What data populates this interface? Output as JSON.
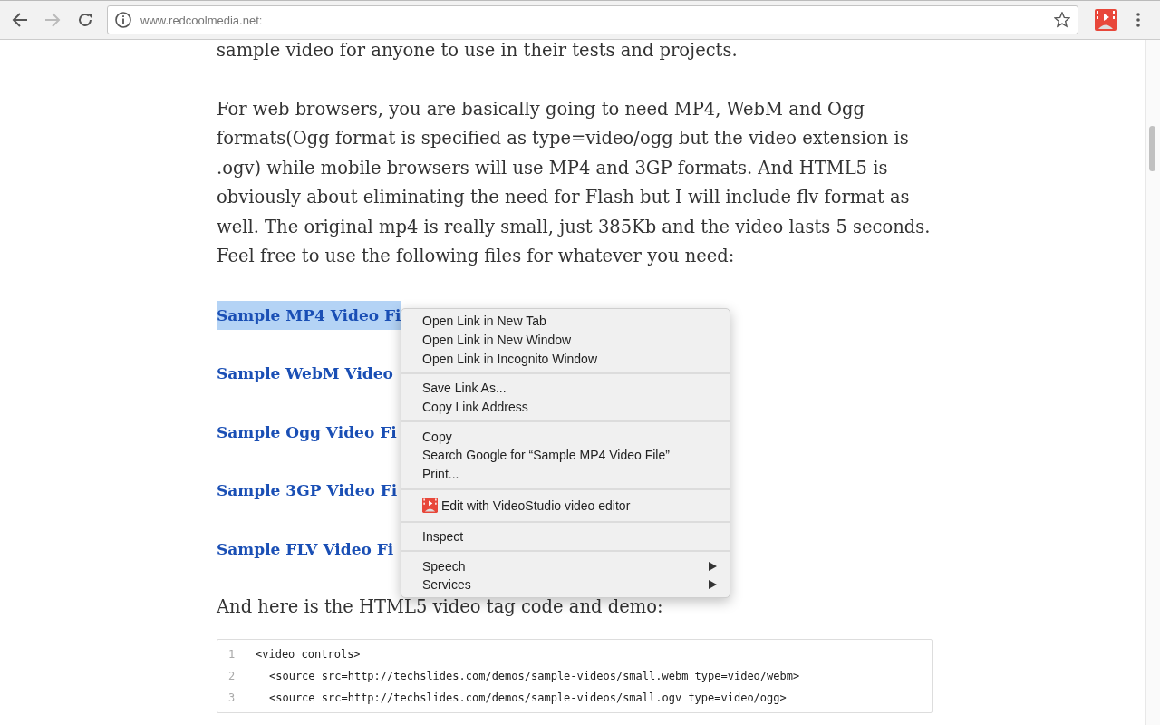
{
  "toolbar": {
    "url_host": "www.redcoolmedia.net",
    "url_rest": ":",
    "bookmarked": false
  },
  "article": {
    "paragraphs": [
      "sample video for anyone to use in their tests and projects.",
      "For web browsers, you are basically going to need MP4, WebM and Ogg formats(Ogg format is specified as type=video/ogg but the video extension is .ogv) while mobile browsers will use MP4 and 3GP formats. And HTML5 is obviously about eliminating the need for Flash but I will include flv format as well. The original mp4 is really small, just 385Kb and the video lasts 5 seconds. Feel free to use the following files for whatever you need:"
    ],
    "links": [
      {
        "label": "Sample MP4 Video Fi",
        "selected": true
      },
      {
        "label": "Sample WebM Video",
        "selected": false
      },
      {
        "label": "Sample Ogg Video Fi",
        "selected": false
      },
      {
        "label": "Sample 3GP Video Fi",
        "selected": false
      },
      {
        "label": "Sample FLV Video Fi",
        "selected": false
      }
    ],
    "after_links": "And here is the HTML5 video tag code and demo:",
    "code": [
      {
        "number": "1",
        "line": "<video controls>",
        "indent": false
      },
      {
        "number": "2",
        "line": "<source src=http://techslides.com/demos/sample-videos/small.webm type=video/webm>",
        "indent": true
      },
      {
        "number": "3",
        "line": "<source src=http://techslides.com/demos/sample-videos/small.ogv type=video/ogg>",
        "indent": true
      }
    ]
  },
  "context_menu": {
    "groups": [
      [
        {
          "label": "Open Link in New Tab",
          "kind": "plain"
        },
        {
          "label": "Open Link in New Window",
          "kind": "plain"
        },
        {
          "label": "Open Link in Incognito Window",
          "kind": "plain"
        }
      ],
      [
        {
          "label": "Save Link As...",
          "kind": "plain"
        },
        {
          "label": "Copy Link Address",
          "kind": "plain"
        }
      ],
      [
        {
          "label": "Copy",
          "kind": "plain"
        },
        {
          "label": "Search Google for “Sample MP4 Video File”",
          "kind": "plain"
        },
        {
          "label": "Print...",
          "kind": "plain"
        }
      ],
      [
        {
          "label": "Edit with VideoStudio video editor",
          "kind": "app"
        }
      ],
      [
        {
          "label": "Inspect",
          "kind": "plain"
        }
      ],
      [
        {
          "label": "Speech",
          "kind": "submenu"
        },
        {
          "label": "Services",
          "kind": "submenu"
        }
      ]
    ]
  }
}
